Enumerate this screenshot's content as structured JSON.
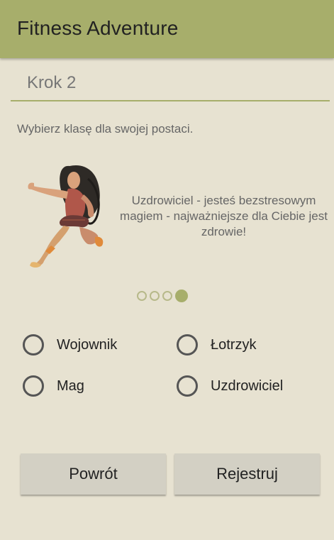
{
  "app": {
    "title": "Fitness Adventure"
  },
  "step": {
    "title": "Krok 2"
  },
  "instruction": "Wybierz klasę dla swojej postaci.",
  "character": {
    "description": "Uzdrowiciel - jesteś bezstresowym magiem - najważniejsze dla Ciebie jest zdrowie!"
  },
  "carousel": {
    "total": 4,
    "active_index": 3
  },
  "classes": [
    {
      "label": "Wojownik",
      "selected": false
    },
    {
      "label": "Łotrzyk",
      "selected": false
    },
    {
      "label": "Mag",
      "selected": false
    },
    {
      "label": "Uzdrowiciel",
      "selected": false
    }
  ],
  "buttons": {
    "back": "Powrót",
    "register": "Rejestruj"
  },
  "colors": {
    "accent": "#a7ae6b",
    "background": "#e7e2d1",
    "button": "#d3d0c4"
  }
}
